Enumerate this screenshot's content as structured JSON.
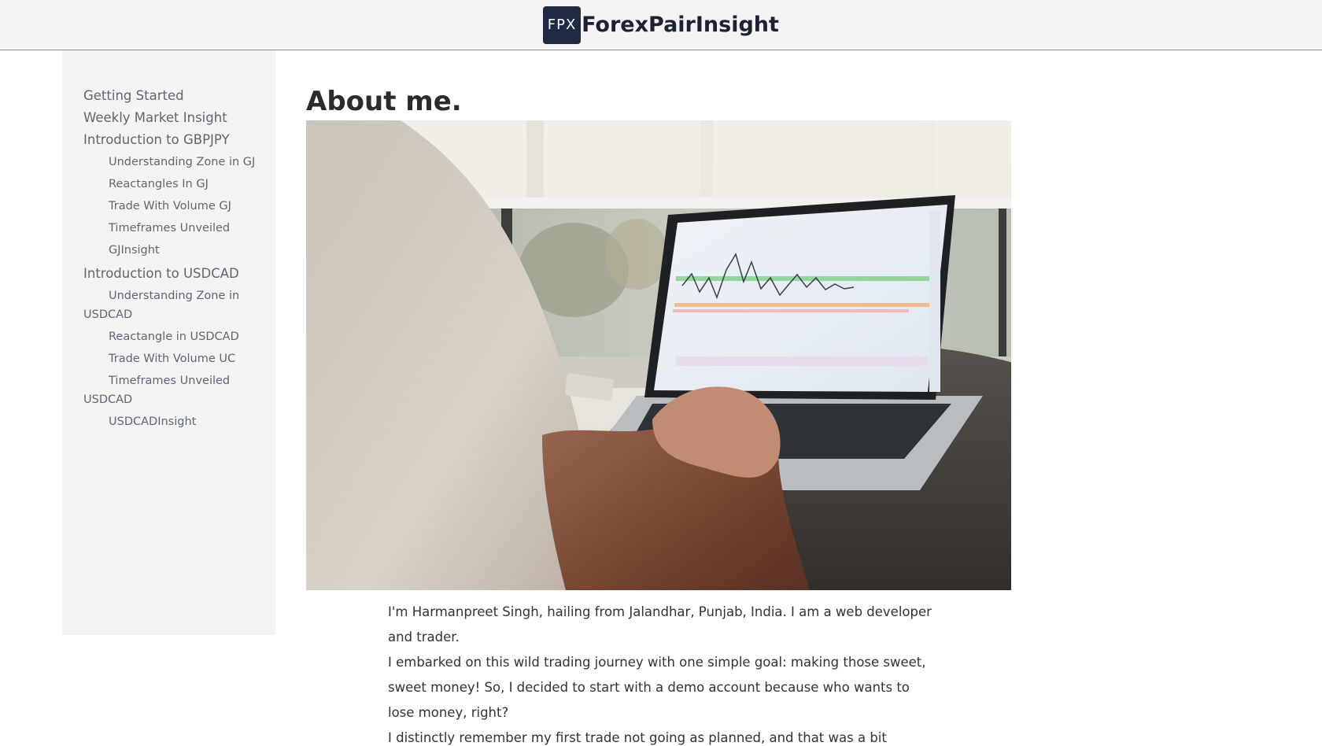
{
  "header": {
    "logo_text": "FPX",
    "brand_name": "ForexPairInsight"
  },
  "sidebar": {
    "items": [
      {
        "label": "Getting Started",
        "level": 0
      },
      {
        "label": "Weekly Market Insight",
        "level": 0
      },
      {
        "label": "Introduction to GBPJPY",
        "level": 0
      },
      {
        "label": "Understanding Zone in GJ",
        "level": 1
      },
      {
        "label": "Reactangles In GJ",
        "level": 1
      },
      {
        "label": "Trade With Volume GJ",
        "level": 1
      },
      {
        "label": "Timeframes Unveiled",
        "level": 1
      },
      {
        "label": "GJInsight",
        "level": 1
      },
      {
        "label": "Introduction to USDCAD",
        "level": 0
      },
      {
        "label": "Understanding Zone in USDCAD",
        "level": 1
      },
      {
        "label": "Reactangle in USDCAD",
        "level": 1
      },
      {
        "label": "Trade With Volume UC",
        "level": 1
      },
      {
        "label": "Timeframes Unveiled USDCAD",
        "level": 1
      },
      {
        "label": "USDCADInsight",
        "level": 1
      }
    ]
  },
  "main": {
    "title": "About me.",
    "paragraphs": [
      "I'm Harmanpreet Singh, hailing from Jalandhar, Punjab, India. I am a web developer and trader.",
      "I embarked on this wild trading journey with one simple goal: making those sweet, sweet money! So, I decided to start with a demo account because who wants to lose money, right?",
      "I distinctly remember my first trade not going as planned, and that was a bit discouraging."
    ]
  },
  "colors": {
    "logo_bg": "#1f2a44",
    "sidebar_bg": "#f4f4f4",
    "link": "#5d6673"
  }
}
